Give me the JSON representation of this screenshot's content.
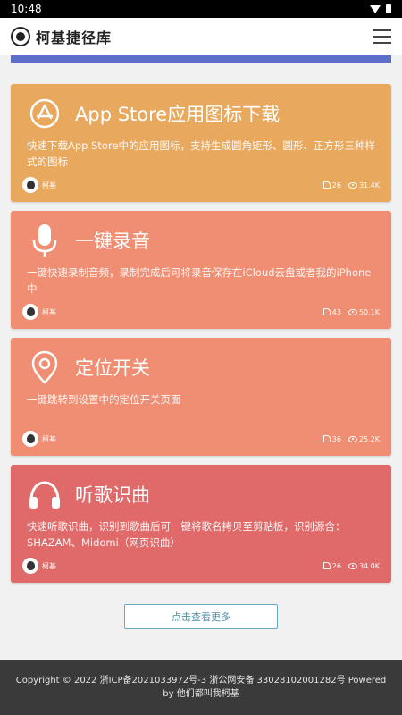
{
  "status": {
    "time": "10:48"
  },
  "nav": {
    "brand": "柯基捷径库"
  },
  "cards": [
    {
      "title": "App Store应用图标下载",
      "desc": "快速下载App Store中的应用图标，支持生成圆角矩形、圆形、正方形三种样式的图标",
      "author": "柯基",
      "likes": "26",
      "views": "31.4K",
      "color": "#e8a95f"
    },
    {
      "title": "一键录音",
      "desc": "一键快速录制音频，录制完成后可将录音保存在iCloud云盘或者我的iPhone中",
      "author": "柯基",
      "likes": "43",
      "views": "50.1K",
      "color": "#ef8e72"
    },
    {
      "title": "定位开关",
      "desc": "一键跳转到设置中的定位开关页面",
      "author": "柯基",
      "likes": "36",
      "views": "25.2K",
      "color": "#ef8e72"
    },
    {
      "title": "听歌识曲",
      "desc": "快速听歌识曲，识别到歌曲后可一键将歌名拷贝至剪贴板，识别源含：SHAZAM、Midomi（网页识曲）",
      "author": "柯基",
      "likes": "26",
      "views": "34.0K",
      "color": "#e06a6a"
    }
  ],
  "top_card": {
    "color": "#5c6ec8"
  },
  "more": {
    "label": "点击查看更多"
  },
  "footer": {
    "text": "Copyright © 2022 浙ICP备2021033972号-3 浙公网安备 33028102001282号 Powered by 他们都叫我柯基"
  }
}
